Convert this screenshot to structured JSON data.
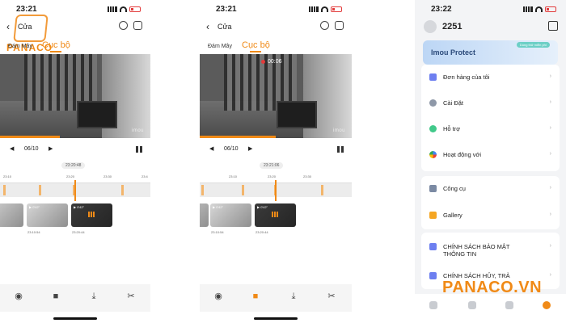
{
  "colors": {
    "accent": "#f08a17",
    "record_dot": "#e23a3a",
    "battery": "#e23a3a"
  },
  "watermark": {
    "text": "PANACO",
    "bottom_brand": "PANACO.VN"
  },
  "left": {
    "status_time": "23:21",
    "title": "Cửa",
    "tab_cloud": "Đám Mây",
    "tab_local": "Cục bộ",
    "video_watermark": "imou",
    "date": "06/10",
    "current_time": "23:20:48",
    "timeline_labels": [
      "23:10",
      "23:20",
      "23:30",
      "23:4"
    ],
    "clips": [
      {
        "duration": "",
        "time": ""
      },
      {
        "duration": "▶ 0'42\"",
        "time": "23:10:54"
      },
      {
        "duration": "▶ 0'42\"",
        "time": "23:20:44"
      }
    ]
  },
  "middle": {
    "status_time": "23:21",
    "title": "Cửa",
    "tab_cloud": "Đám Mây",
    "tab_local": "Cục bộ",
    "rec_time": "00:06",
    "video_watermark": "imou",
    "date": "06/10",
    "current_time": "23:21:06",
    "timeline_labels": [
      "23:10",
      "23:20",
      "23:30"
    ],
    "clips": [
      {
        "duration": "▶ 0'42\"",
        "time": "23:10:54"
      },
      {
        "duration": "▶ 0'42\"",
        "time": "23:20:44"
      }
    ]
  },
  "right": {
    "status_time": "23:22",
    "user_id": "2251",
    "banner_title": "Imou Protect",
    "banner_trial": "Dùng thử miễn phí",
    "group1": [
      "Đơn hàng của tôi",
      "Cài Đặt",
      "Hỗ trợ",
      "Hoạt động với"
    ],
    "group2": [
      "Công cụ",
      "Gallery"
    ],
    "group3": [
      "CHÍNH SÁCH BẢO MẬT THÔNG TIN",
      "CHÍNH SÁCH HỦY, TRẢ"
    ]
  },
  "icons": {
    "back": "‹",
    "next": "›",
    "play_left": "◀",
    "play_right": "▶",
    "camera": "◉",
    "video": "■",
    "download": "⤓",
    "scissors": "✂"
  }
}
